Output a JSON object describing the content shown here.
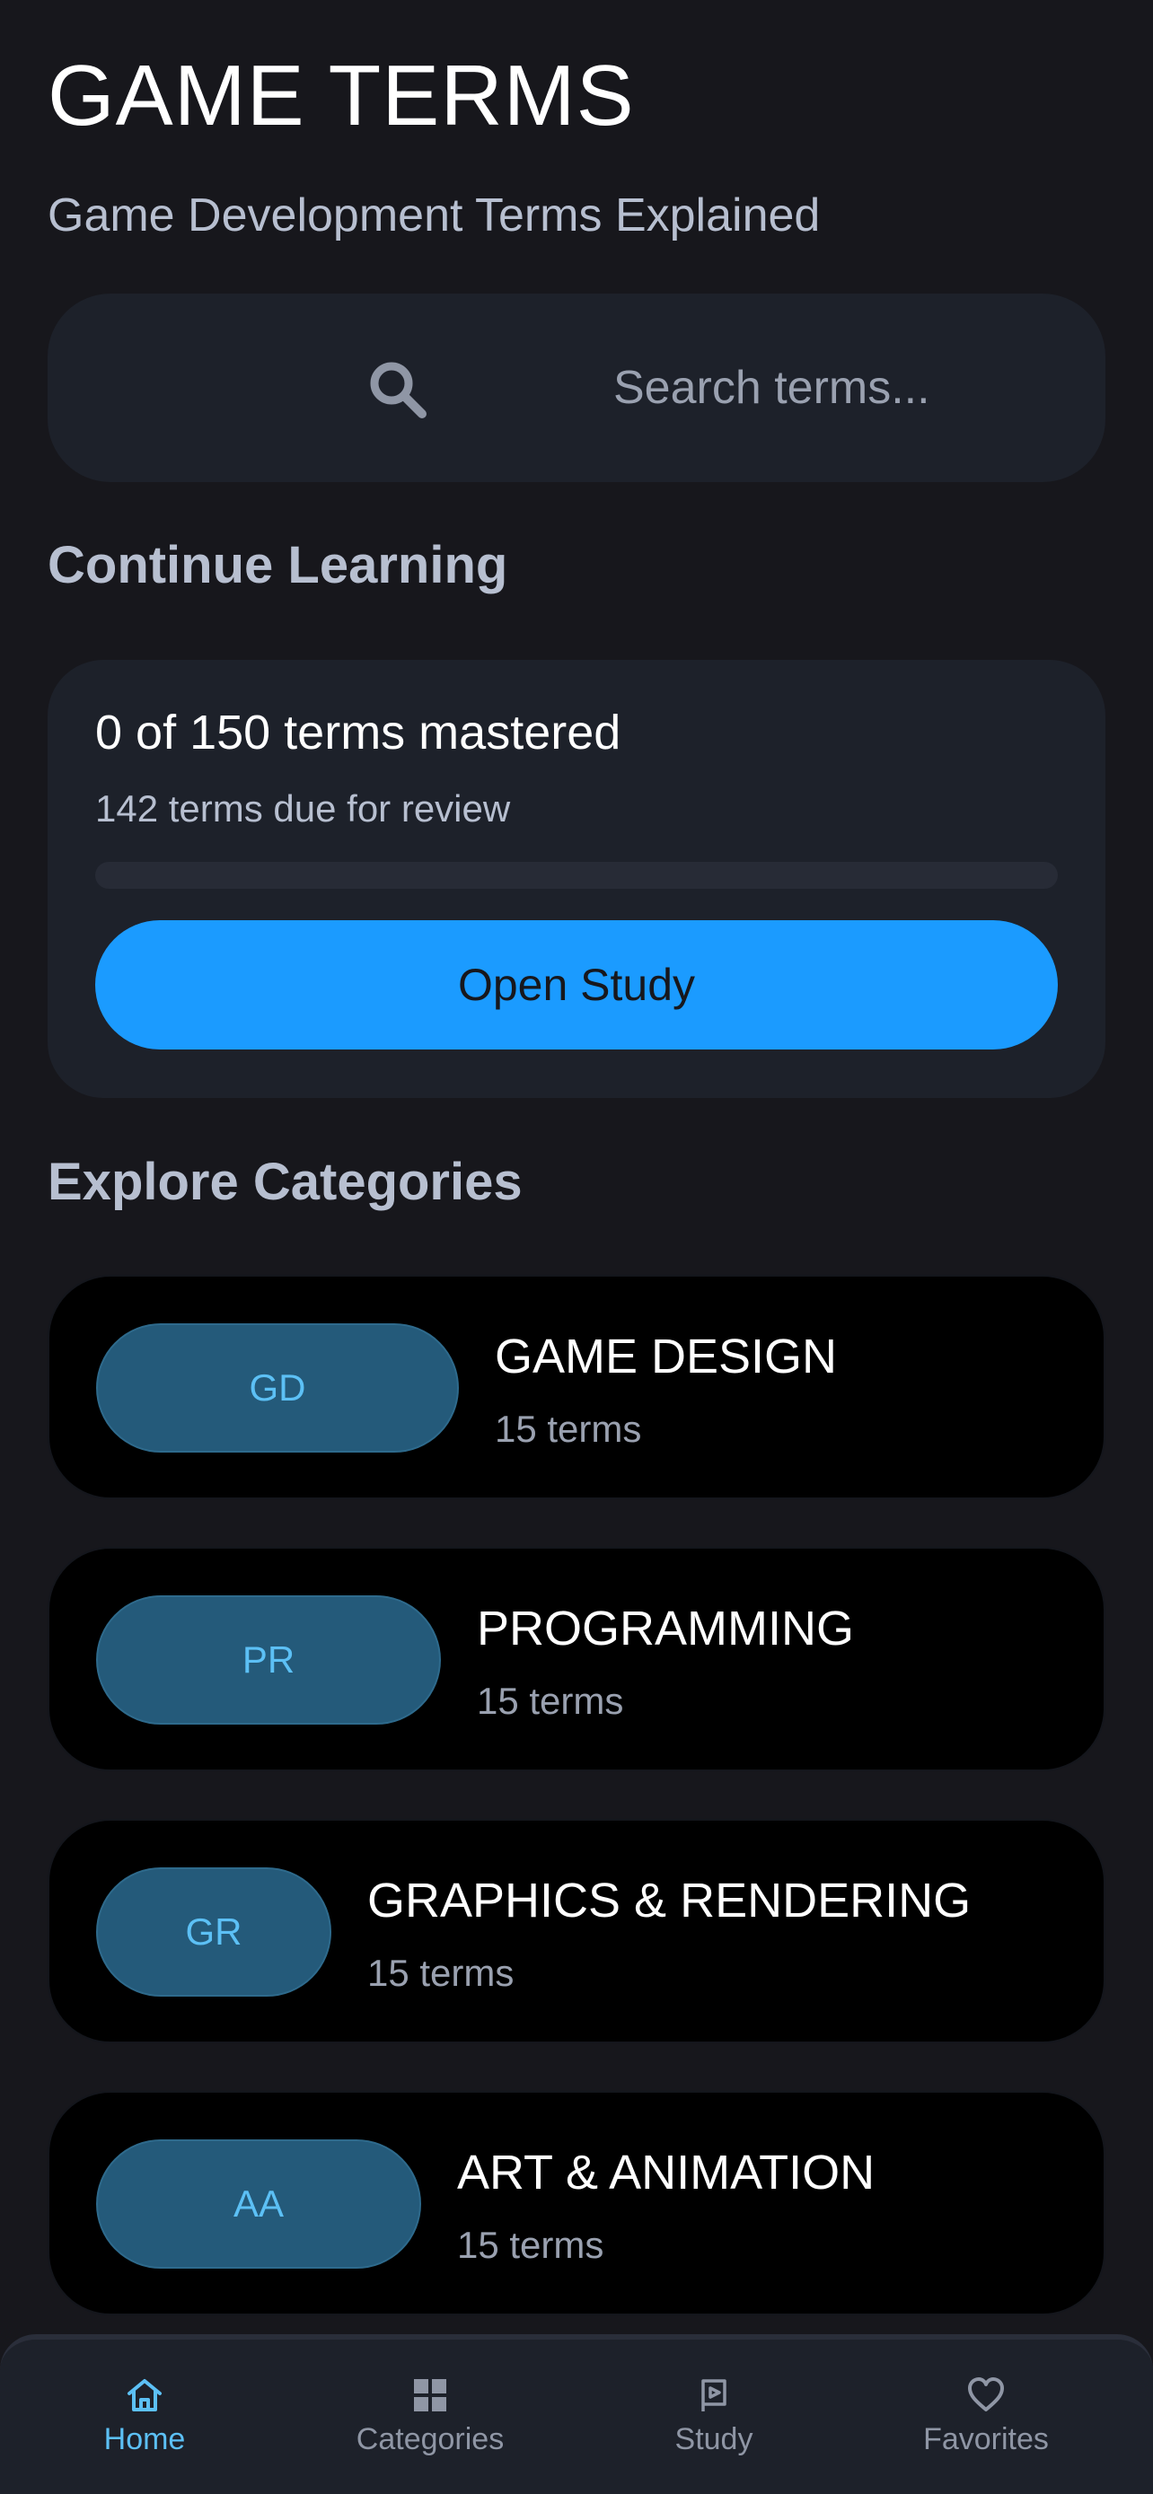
{
  "header": {
    "title": "GAME TERMS",
    "subtitle": "Game Development Terms Explained"
  },
  "search": {
    "placeholder": "Search terms...",
    "value": "",
    "icon": "search-icon"
  },
  "continue_learning": {
    "heading": "Continue Learning",
    "mastered_text": "0 of 150 terms mastered",
    "due_text": "142 terms due for review",
    "mastered": 0,
    "total": 150,
    "progress_fraction": 0,
    "button_label": "Open Study"
  },
  "categories_section": {
    "heading": "Explore Categories",
    "items": [
      {
        "badge": "GD",
        "name": "GAME DESIGN",
        "count": "15 terms"
      },
      {
        "badge": "PR",
        "name": "PROGRAMMING",
        "count": "15 terms"
      },
      {
        "badge": "GR",
        "name": "GRAPHICS & RENDERING",
        "count": "15 terms"
      },
      {
        "badge": "AA",
        "name": "ART & ANIMATION",
        "count": "15 terms"
      }
    ]
  },
  "bottom_nav": {
    "items": [
      {
        "label": "Home",
        "icon": "home-icon",
        "active": true
      },
      {
        "label": "Categories",
        "icon": "grid-icon",
        "active": false
      },
      {
        "label": "Study",
        "icon": "flag-icon",
        "active": false
      },
      {
        "label": "Favorites",
        "icon": "heart-icon",
        "active": false
      }
    ]
  },
  "colors": {
    "background": "#17171c",
    "card": "#1d212a",
    "accent": "#1b9bff",
    "badge_bg": "#245a7a",
    "badge_text": "#5cc0f5",
    "muted_text": "#9aa1b0"
  }
}
